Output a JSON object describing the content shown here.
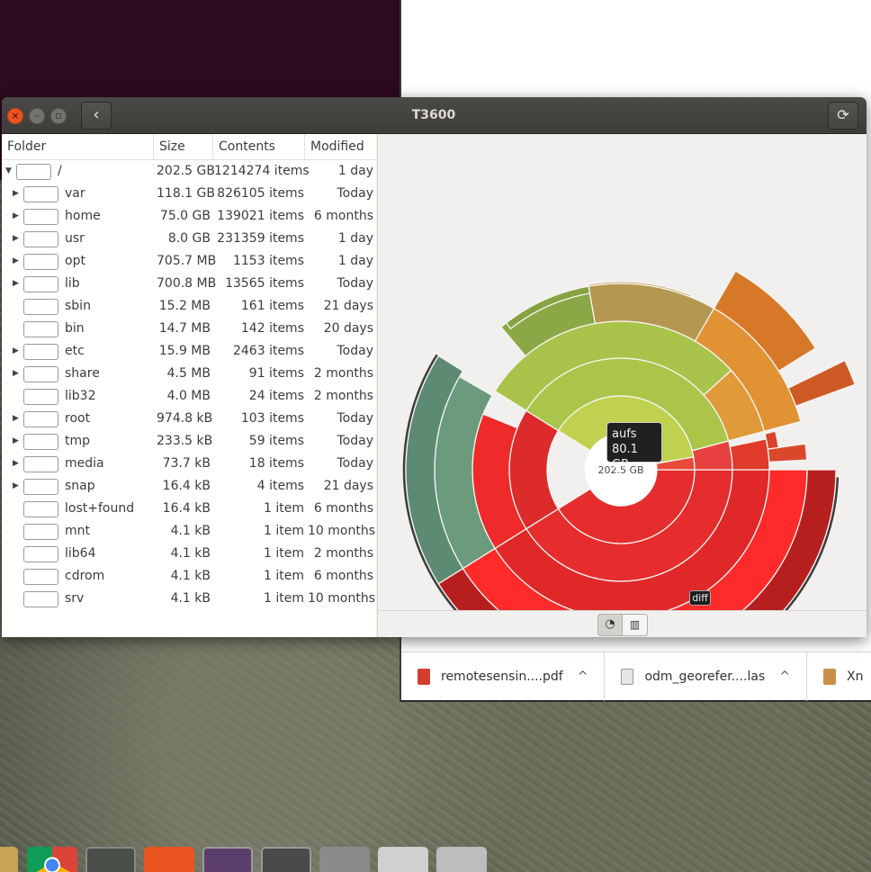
{
  "window": {
    "title": "T3600"
  },
  "columns": {
    "folder": "Folder",
    "size": "Size",
    "contents": "Contents",
    "modified": "Modified"
  },
  "rows": [
    {
      "name": "/",
      "size": "202.5 GB",
      "contents": "1214274 items",
      "modified": "1 day",
      "expanded": true,
      "expandable": true
    },
    {
      "name": "var",
      "size": "118.1 GB",
      "contents": "826105 items",
      "modified": "Today",
      "expandable": true
    },
    {
      "name": "home",
      "size": "75.0 GB",
      "contents": "139021 items",
      "modified": "6 months",
      "expandable": true
    },
    {
      "name": "usr",
      "size": "8.0 GB",
      "contents": "231359 items",
      "modified": "1 day",
      "expandable": true
    },
    {
      "name": "opt",
      "size": "705.7 MB",
      "contents": "1153 items",
      "modified": "1 day",
      "expandable": true
    },
    {
      "name": "lib",
      "size": "700.8 MB",
      "contents": "13565 items",
      "modified": "Today",
      "expandable": true
    },
    {
      "name": "sbin",
      "size": "15.2 MB",
      "contents": "161 items",
      "modified": "21 days",
      "expandable": false
    },
    {
      "name": "bin",
      "size": "14.7 MB",
      "contents": "142 items",
      "modified": "20 days",
      "expandable": false
    },
    {
      "name": "etc",
      "size": "15.9 MB",
      "contents": "2463 items",
      "modified": "Today",
      "expandable": true
    },
    {
      "name": "share",
      "size": "4.5 MB",
      "contents": "91 items",
      "modified": "2 months",
      "expandable": true
    },
    {
      "name": "lib32",
      "size": "4.0 MB",
      "contents": "24 items",
      "modified": "2 months",
      "expandable": false
    },
    {
      "name": "root",
      "size": "974.8 kB",
      "contents": "103 items",
      "modified": "Today",
      "expandable": true
    },
    {
      "name": "tmp",
      "size": "233.5 kB",
      "contents": "59 items",
      "modified": "Today",
      "expandable": true
    },
    {
      "name": "media",
      "size": "73.7 kB",
      "contents": "18 items",
      "modified": "Today",
      "expandable": true
    },
    {
      "name": "snap",
      "size": "16.4 kB",
      "contents": "4 items",
      "modified": "21 days",
      "expandable": true
    },
    {
      "name": "lost+found",
      "size": "16.4 kB",
      "contents": "1 item",
      "modified": "6 months",
      "expandable": false
    },
    {
      "name": "mnt",
      "size": "4.1 kB",
      "contents": "1 item",
      "modified": "10 months",
      "expandable": false
    },
    {
      "name": "lib64",
      "size": "4.1 kB",
      "contents": "1 item",
      "modified": "2 months",
      "expandable": false
    },
    {
      "name": "cdrom",
      "size": "4.1 kB",
      "contents": "1 item",
      "modified": "6 months",
      "expandable": false
    },
    {
      "name": "srv",
      "size": "4.1 kB",
      "contents": "1 item",
      "modified": "10 months",
      "expandable": false
    }
  ],
  "chart": {
    "center_label": "202.5 GB",
    "tooltip_name": "aufs",
    "tooltip_size": "80.1 GB",
    "hover_label": "diff",
    "colors": {
      "var": "#e52d2d",
      "home": "#a3c24a",
      "usr": "#e8913a",
      "green_dark": "#6b9a7c"
    }
  },
  "downloads": [
    {
      "name": "remotesensin....pdf",
      "icon": "pdf-icon"
    },
    {
      "name": "odm_georefer....las",
      "icon": "file-icon"
    },
    {
      "name": "Xn",
      "icon": "package-icon"
    }
  ]
}
